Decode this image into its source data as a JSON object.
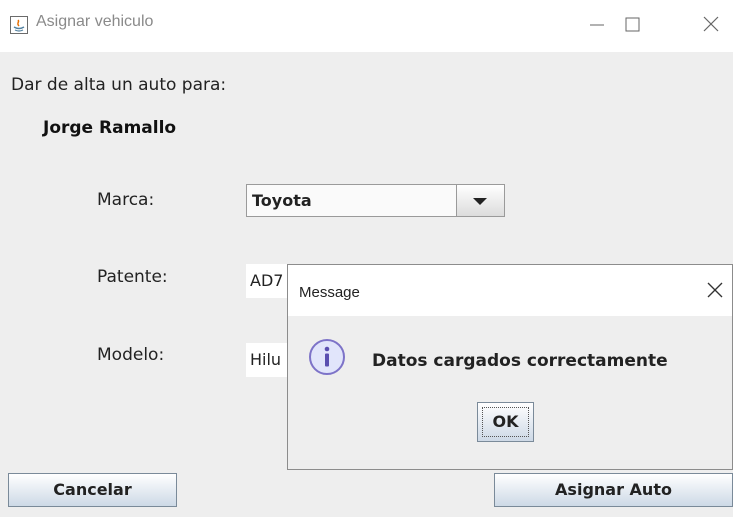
{
  "window": {
    "title": "Asignar vehiculo"
  },
  "form": {
    "intro": "Dar de alta un auto para:",
    "owner_name": "Jorge Ramallo",
    "marca_label": "Marca:",
    "marca_value": "Toyota",
    "patente_label": "Patente:",
    "patente_value": "AD7",
    "modelo_label": "Modelo:",
    "modelo_value": "Hilu"
  },
  "buttons": {
    "cancel": "Cancelar",
    "assign": "Asignar Auto"
  },
  "dialog": {
    "title": "Message",
    "message": "Datos cargados correctamente",
    "ok": "OK"
  },
  "icons": {
    "app": "java-icon",
    "info": "info-icon",
    "minimize": "minimize-icon",
    "maximize": "maximize-icon",
    "close": "close-icon",
    "dropdown": "triangle-down-icon"
  },
  "colors": {
    "info_icon_fill": "#e1e5fb",
    "info_icon_stroke": "#7d73c8",
    "button_bottom": "#cdd9e6"
  }
}
